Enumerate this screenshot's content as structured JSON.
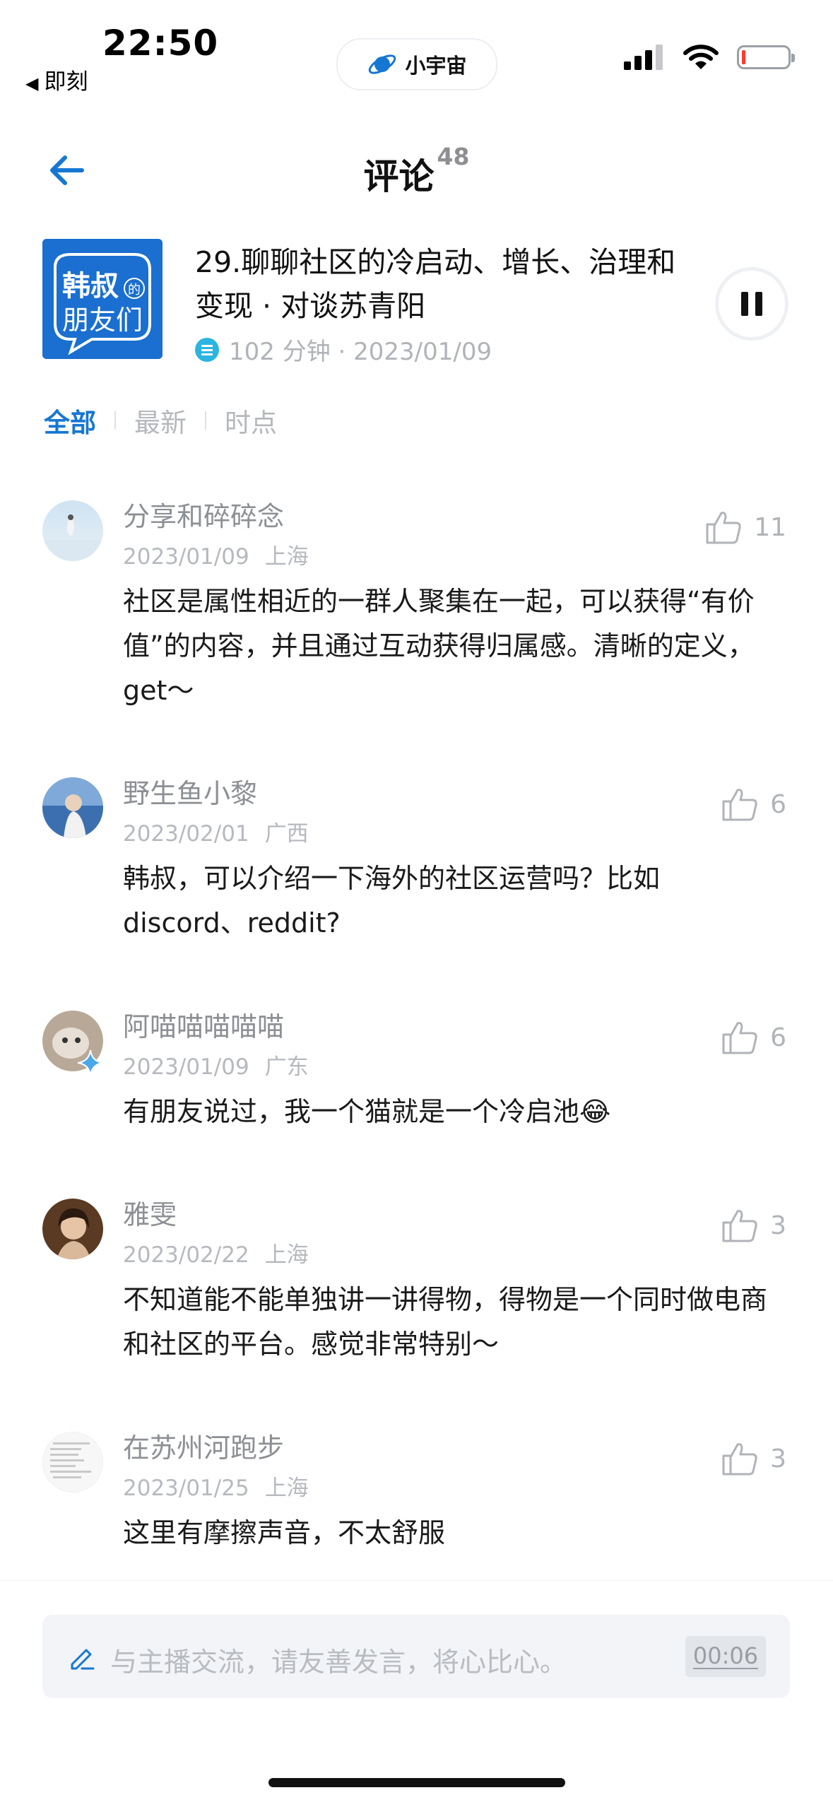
{
  "status_bar": {
    "time": "22:50",
    "back_app": "即刻",
    "app_pill_label": "小宇宙"
  },
  "header": {
    "title": "评论",
    "count": "48"
  },
  "episode": {
    "cover_text_main": "韩叔",
    "cover_text_small": "的",
    "cover_text_sub": "朋友们",
    "title": "29.聊聊社区的冷启动、增长、治理和变现 · 对谈苏青阳",
    "meta": "102 分钟 · 2023/01/09"
  },
  "tabs": [
    {
      "label": "全部",
      "active": true
    },
    {
      "label": "最新",
      "active": false
    },
    {
      "label": "时点",
      "active": false
    }
  ],
  "comments": [
    {
      "name": "分享和碎碎念",
      "date": "2023/01/09",
      "location": "上海",
      "likes": "11",
      "text": "社区是属性相近的一群人聚集在一起，可以获得“有价值”的内容，并且通过互动获得归属感。清晰的定义，get～"
    },
    {
      "name": "野生鱼小黎",
      "date": "2023/02/01",
      "location": "广西",
      "likes": "6",
      "text": "韩叔，可以介绍一下海外的社区运营吗？比如 discord、reddit?"
    },
    {
      "name": "阿喵喵喵喵喵",
      "date": "2023/01/09",
      "location": "广东",
      "likes": "6",
      "text": "有朋友说过，我一个猫就是一个冷启池😂"
    },
    {
      "name": "雅雯",
      "date": "2023/02/22",
      "location": "上海",
      "likes": "3",
      "text": "不知道能不能单独讲一讲得物，得物是一个同时做电商和社区的平台。感觉非常特别～"
    },
    {
      "name": "在苏州河跑步",
      "date": "2023/01/25",
      "location": "上海",
      "likes": "3",
      "text": "这里有摩擦声音，不太舒服"
    }
  ],
  "input": {
    "placeholder": "与主播交流，请友善发言，将心比心。",
    "timestamp": "00:06"
  },
  "colors": {
    "accent": "#1677d2",
    "cover_bg": "#1a6fd0"
  }
}
